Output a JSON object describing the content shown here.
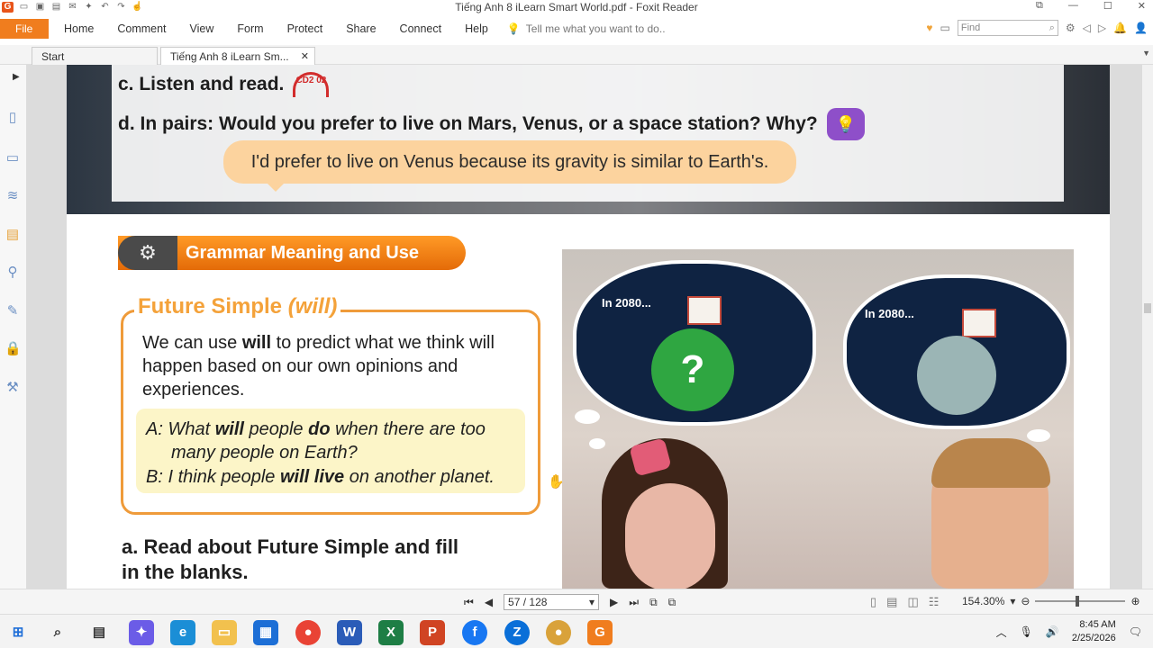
{
  "window": {
    "title": "Tiếng Anh 8 iLearn Smart World.pdf - Foxit Reader"
  },
  "menu": {
    "file": "File",
    "items": [
      "Home",
      "Comment",
      "View",
      "Form",
      "Protect",
      "Share",
      "Connect",
      "Help"
    ],
    "tell_me": "Tell me what you want to do.."
  },
  "find": {
    "placeholder": "Find"
  },
  "tabs": [
    "Start",
    "Tiếng Anh 8 iLearn Sm..."
  ],
  "page": {
    "line_c": "c. Listen and read.",
    "cd_label": "CD2 02",
    "line_d": "d. In pairs: Would you prefer to live on Mars, Venus, or a space station? Why?",
    "speech": "I'd prefer to live on Venus because its gravity is similar to Earth's.",
    "grammar_banner": "Grammar Meaning and Use",
    "future_title": "Future Simple",
    "future_title_will": "(will)",
    "future_desc_pre": "We can use ",
    "future_desc_bold": "will",
    "future_desc_post": " to predict what we think will happen based on our own opinions and experiences.",
    "ex_a_1": "A: What ",
    "ex_a_will": "will",
    "ex_a_2": " people ",
    "ex_a_do": "do",
    "ex_a_3": " when there are too",
    "ex_a_line2": "many people on Earth?",
    "ex_b_1": "B: I think people ",
    "ex_b_will": "will live",
    "ex_b_2": " on another planet.",
    "task_a": "a. Read about Future Simple and fill in the blanks.",
    "cloud1": "In 2080...",
    "cloud2": "In 2080...",
    "question_mark": "?"
  },
  "status": {
    "page_display": "57 / 128",
    "zoom": "154.30%"
  },
  "clock": {
    "time": "8:45 AM",
    "date": "2/25/2026"
  },
  "colors": {
    "accent": "#f07d1e",
    "grammar_banner": "#f08a1f",
    "speech": "#fcd39e",
    "future_border": "#ef9b3a"
  }
}
